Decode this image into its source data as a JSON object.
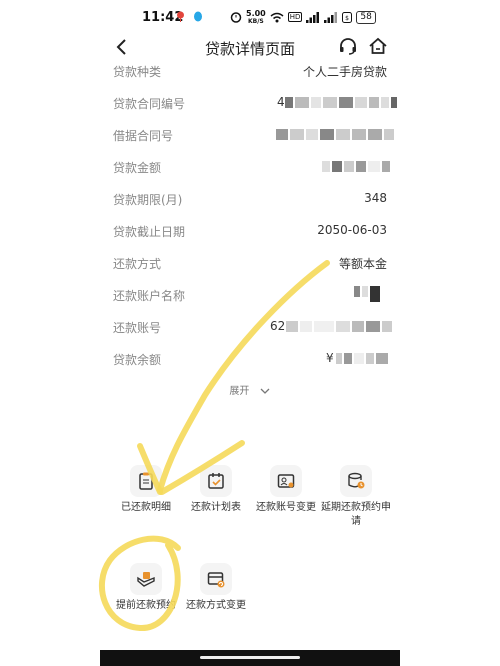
{
  "status": {
    "time": "11:42",
    "speed": "5.00",
    "speed_unit": "KB/S",
    "hd": "HD",
    "battery": "58"
  },
  "header": {
    "title": "贷款详情页面"
  },
  "details": [
    {
      "label": "贷款种类",
      "value": "个人二手房贷款"
    },
    {
      "label": "贷款合同编号",
      "value": "4"
    },
    {
      "label": "借据合同号",
      "value": ""
    },
    {
      "label": "贷款金额",
      "value": ""
    },
    {
      "label": "贷款期限(月)",
      "value": "348"
    },
    {
      "label": "贷款截止日期",
      "value": "2050-06-03"
    },
    {
      "label": "还款方式",
      "value": "等额本金"
    },
    {
      "label": "还款账户名称",
      "value": ""
    },
    {
      "label": "还款账号",
      "value": "62"
    },
    {
      "label": "贷款余额",
      "value": "¥"
    }
  ],
  "expand_label": "展开",
  "functions": [
    {
      "label": "已还款明细",
      "icon": "clipboard-icon"
    },
    {
      "label": "还款计划表",
      "icon": "calendar-check-icon"
    },
    {
      "label": "还款账号变更",
      "icon": "account-card-icon"
    },
    {
      "label": "延期还款预约申请",
      "icon": "database-clock-icon"
    },
    {
      "label": "提前还款预约",
      "icon": "money-hand-icon"
    },
    {
      "label": "还款方式变更",
      "icon": "card-refresh-icon"
    }
  ],
  "colors": {
    "highlighter": "#F5D95A",
    "accent": "#E8922E"
  }
}
